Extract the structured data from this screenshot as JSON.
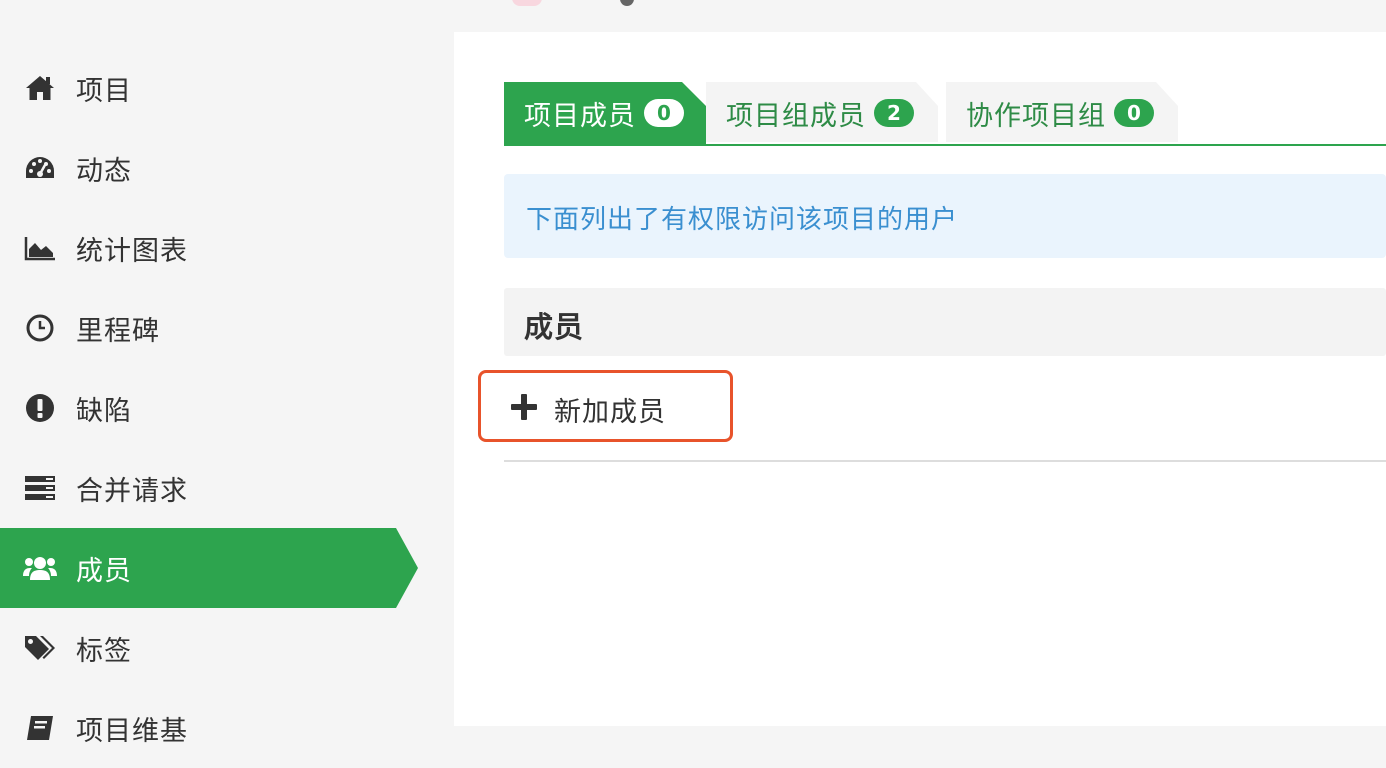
{
  "colors": {
    "accent": "#2da44e",
    "info_bg": "#eaf4fd",
    "info_text": "#3a8fd0",
    "highlight": "#e8532b"
  },
  "sidebar": {
    "items": [
      {
        "label": "项目",
        "icon": "home-icon"
      },
      {
        "label": "动态",
        "icon": "dashboard-icon"
      },
      {
        "label": "统计图表",
        "icon": "area-chart-icon"
      },
      {
        "label": "里程碑",
        "icon": "clock-icon"
      },
      {
        "label": "缺陷",
        "icon": "exclamation-circle-icon"
      },
      {
        "label": "合并请求",
        "icon": "merge-request-icon"
      },
      {
        "label": "成员",
        "icon": "users-icon",
        "active": true
      },
      {
        "label": "标签",
        "icon": "tags-icon"
      },
      {
        "label": "项目维基",
        "icon": "book-icon"
      }
    ]
  },
  "tabs": [
    {
      "label": "项目成员",
      "count": "0",
      "active": true
    },
    {
      "label": "项目组成员",
      "count": "2",
      "active": false
    },
    {
      "label": "协作项目组",
      "count": "0",
      "active": false
    }
  ],
  "info": {
    "text": "下面列出了有权限访问该项目的用户"
  },
  "members": {
    "heading": "成员",
    "add_label": "新加成员"
  }
}
